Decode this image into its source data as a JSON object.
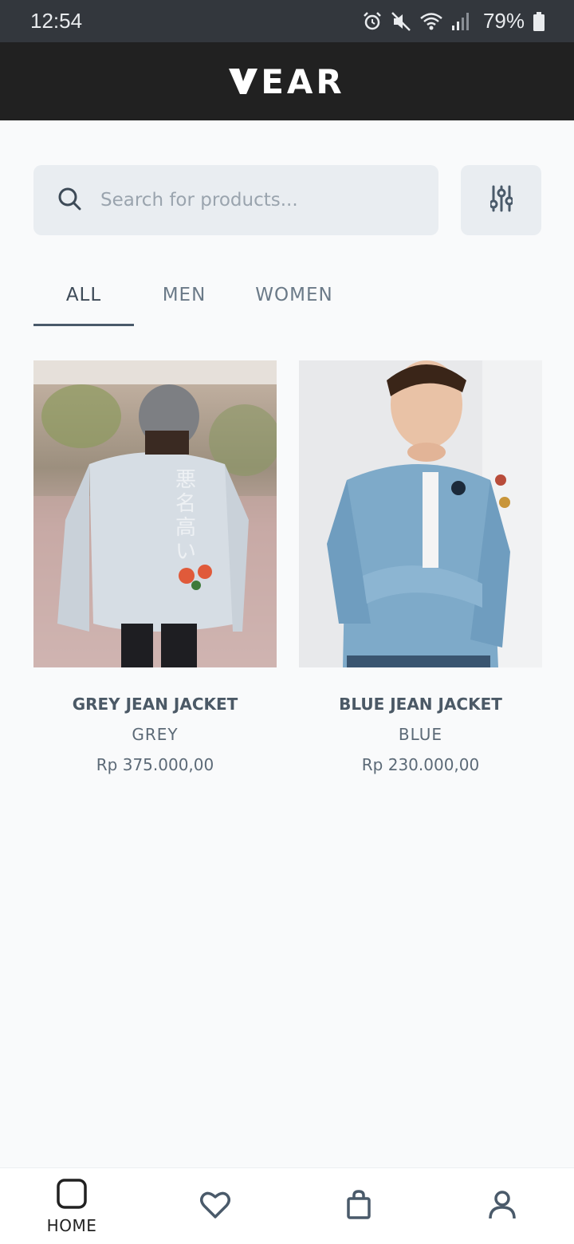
{
  "status_bar": {
    "time": "12:54",
    "battery": "79%",
    "icons": [
      "alarm-icon",
      "mute-icon",
      "wifi-icon",
      "signal-icon",
      "battery-icon"
    ]
  },
  "app": {
    "logo": "EAR"
  },
  "search": {
    "placeholder": "Search for products...",
    "value": ""
  },
  "tabs": [
    {
      "label": "ALL",
      "active": true
    },
    {
      "label": "MEN",
      "active": false
    },
    {
      "label": "WOMEN",
      "active": false
    }
  ],
  "products": [
    {
      "name": "GREY JEAN JACKET",
      "color": "GREY",
      "price": "Rp 375.000,00"
    },
    {
      "name": "BLUE JEAN JACKET",
      "color": "BLUE",
      "price": "Rp 230.000,00"
    }
  ],
  "bottom_nav": [
    {
      "label": "HOME",
      "icon": "home-icon",
      "active": true
    },
    {
      "label": "",
      "icon": "heart-icon",
      "active": false
    },
    {
      "label": "",
      "icon": "bag-icon",
      "active": false
    },
    {
      "label": "",
      "icon": "profile-icon",
      "active": false
    }
  ],
  "colors": {
    "header_bg": "#212121",
    "status_bg": "#33373d",
    "surface": "#e9edf1",
    "text": "#3d4a57"
  }
}
